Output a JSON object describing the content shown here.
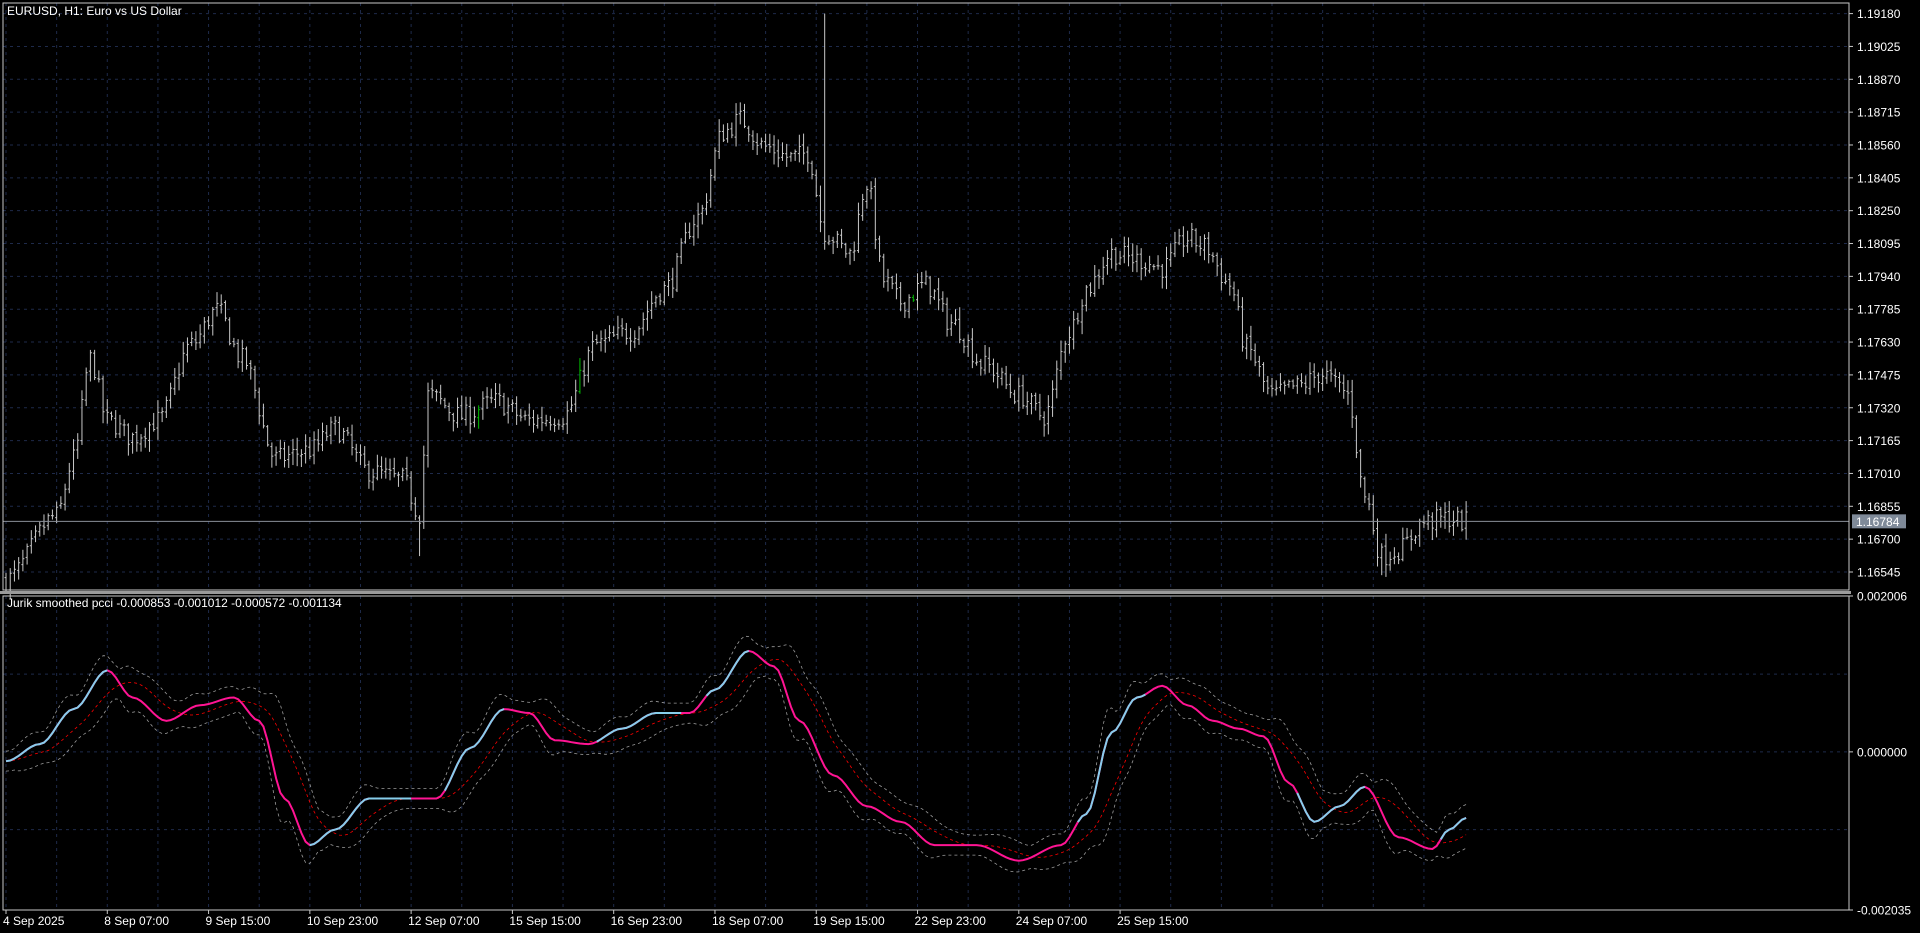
{
  "window": {
    "symbol_title": "EURUSD, H1:  Euro vs US Dollar",
    "indicator_title": "Jurik smoothed pcci -0.000853 -0.001012 -0.000572 -0.001134"
  },
  "colors": {
    "background": "#000000",
    "grid": "#1e2a4a",
    "frame": "#c8c8c8",
    "bar_normal": "#c8c8c8",
    "bar_green": "#00c000",
    "current_price_line": "#8a8f98",
    "current_price_box": "#7f8a99",
    "pcci_up": "#87ceeb",
    "pcci_down": "#ff1493",
    "signal": "#ff0000",
    "bands": "#9a9a9a"
  },
  "chart_data": [
    {
      "type": "candlestick-bars",
      "name": "EURUSD H1",
      "ylim": [
        1.1646,
        1.1923
      ],
      "y_ticks": [
        "1.19180",
        "1.19025",
        "1.18870",
        "1.18715",
        "1.18560",
        "1.18405",
        "1.18250",
        "1.18095",
        "1.17940",
        "1.17785",
        "1.17630",
        "1.17475",
        "1.17320",
        "1.17165",
        "1.17010",
        "1.16855",
        "1.16700",
        "1.16545"
      ],
      "current_price": 1.16784,
      "current_price_label": "1.16784",
      "keypoints": [
        {
          "i": 0,
          "y": 1.1651
        },
        {
          "i": 12,
          "y": 1.1681
        },
        {
          "i": 16,
          "y": 1.1708
        },
        {
          "i": 20,
          "y": 1.1755
        },
        {
          "i": 24,
          "y": 1.1726
        },
        {
          "i": 30,
          "y": 1.1718
        },
        {
          "i": 36,
          "y": 1.1726
        },
        {
          "i": 44,
          "y": 1.1762
        },
        {
          "i": 50,
          "y": 1.1778
        },
        {
          "i": 56,
          "y": 1.1755
        },
        {
          "i": 64,
          "y": 1.1708
        },
        {
          "i": 72,
          "y": 1.1712
        },
        {
          "i": 78,
          "y": 1.1722
        },
        {
          "i": 86,
          "y": 1.1702
        },
        {
          "i": 94,
          "y": 1.1698
        },
        {
          "i": 98,
          "y": 1.1682
        },
        {
          "i": 100,
          "y": 1.1738
        },
        {
          "i": 108,
          "y": 1.1728
        },
        {
          "i": 116,
          "y": 1.1735
        },
        {
          "i": 124,
          "y": 1.1726
        },
        {
          "i": 132,
          "y": 1.1728
        },
        {
          "i": 140,
          "y": 1.1762
        },
        {
          "i": 148,
          "y": 1.1768
        },
        {
          "i": 156,
          "y": 1.1788
        },
        {
          "i": 164,
          "y": 1.1822
        },
        {
          "i": 170,
          "y": 1.1862
        },
        {
          "i": 174,
          "y": 1.1868
        },
        {
          "i": 180,
          "y": 1.1855
        },
        {
          "i": 186,
          "y": 1.185
        },
        {
          "i": 190,
          "y": 1.1852
        },
        {
          "i": 194,
          "y": 1.1815
        },
        {
          "i": 200,
          "y": 1.1805
        },
        {
          "i": 204,
          "y": 1.1838
        },
        {
          "i": 208,
          "y": 1.1792
        },
        {
          "i": 212,
          "y": 1.1782
        },
        {
          "i": 218,
          "y": 1.179
        },
        {
          "i": 224,
          "y": 1.1772
        },
        {
          "i": 232,
          "y": 1.1752
        },
        {
          "i": 240,
          "y": 1.1738
        },
        {
          "i": 246,
          "y": 1.1728
        },
        {
          "i": 252,
          "y": 1.1768
        },
        {
          "i": 256,
          "y": 1.1788
        },
        {
          "i": 262,
          "y": 1.1805
        },
        {
          "i": 268,
          "y": 1.1802
        },
        {
          "i": 274,
          "y": 1.1798
        },
        {
          "i": 280,
          "y": 1.1812
        },
        {
          "i": 284,
          "y": 1.1808
        },
        {
          "i": 290,
          "y": 1.179
        },
        {
          "i": 294,
          "y": 1.176
        },
        {
          "i": 300,
          "y": 1.1738
        },
        {
          "i": 306,
          "y": 1.1742
        },
        {
          "i": 312,
          "y": 1.1748
        },
        {
          "i": 316,
          "y": 1.1742
        },
        {
          "i": 318,
          "y": 1.1738
        },
        {
          "i": 322,
          "y": 1.169
        },
        {
          "i": 326,
          "y": 1.1662
        },
        {
          "i": 330,
          "y": 1.1665
        },
        {
          "i": 336,
          "y": 1.1678
        },
        {
          "i": 342,
          "y": 1.168
        },
        {
          "i": 346,
          "y": 1.1678
        }
      ],
      "extremes": [
        {
          "i": 194,
          "high": 1.1918
        },
        {
          "i": 98,
          "low": 1.1662
        },
        {
          "i": 326,
          "low": 1.1653
        }
      ],
      "green_bars": [
        112,
        136,
        215
      ]
    },
    {
      "type": "line",
      "name": "Jurik smoothed pcci",
      "ylim": [
        -0.002035,
        0.002006
      ],
      "y_ticks": [
        "0.002006",
        "0.000000",
        "-0.002035"
      ],
      "values": [
        -0.000853,
        -0.001012,
        -0.000572,
        -0.001134
      ],
      "pcci_keypoints": [
        {
          "i": 0,
          "y": -0.00012
        },
        {
          "i": 8,
          "y": 0.0001
        },
        {
          "i": 16,
          "y": 0.00055
        },
        {
          "i": 24,
          "y": 0.00105
        },
        {
          "i": 30,
          "y": 0.0007
        },
        {
          "i": 38,
          "y": 0.0004
        },
        {
          "i": 46,
          "y": 0.0006
        },
        {
          "i": 54,
          "y": 0.0007
        },
        {
          "i": 60,
          "y": 0.0004
        },
        {
          "i": 66,
          "y": -0.0006
        },
        {
          "i": 72,
          "y": -0.0012
        },
        {
          "i": 78,
          "y": -0.001
        },
        {
          "i": 86,
          "y": -0.0006
        },
        {
          "i": 94,
          "y": -0.0006
        },
        {
          "i": 102,
          "y": -0.0006
        },
        {
          "i": 110,
          "y": 5e-05
        },
        {
          "i": 118,
          "y": 0.00055
        },
        {
          "i": 124,
          "y": 0.0005
        },
        {
          "i": 130,
          "y": 0.00015
        },
        {
          "i": 138,
          "y": 0.0001
        },
        {
          "i": 146,
          "y": 0.0003
        },
        {
          "i": 154,
          "y": 0.0005
        },
        {
          "i": 162,
          "y": 0.0005
        },
        {
          "i": 168,
          "y": 0.0008
        },
        {
          "i": 176,
          "y": 0.0013
        },
        {
          "i": 182,
          "y": 0.0011
        },
        {
          "i": 188,
          "y": 0.0004
        },
        {
          "i": 196,
          "y": -0.0003
        },
        {
          "i": 204,
          "y": -0.0007
        },
        {
          "i": 212,
          "y": -0.0009
        },
        {
          "i": 220,
          "y": -0.0012
        },
        {
          "i": 230,
          "y": -0.0012
        },
        {
          "i": 240,
          "y": -0.0014
        },
        {
          "i": 250,
          "y": -0.0012
        },
        {
          "i": 256,
          "y": -0.0008
        },
        {
          "i": 262,
          "y": 0.00025
        },
        {
          "i": 268,
          "y": 0.0007
        },
        {
          "i": 274,
          "y": 0.00085
        },
        {
          "i": 280,
          "y": 0.0006
        },
        {
          "i": 286,
          "y": 0.0004
        },
        {
          "i": 292,
          "y": 0.0003
        },
        {
          "i": 298,
          "y": 0.0002
        },
        {
          "i": 304,
          "y": -0.0004
        },
        {
          "i": 310,
          "y": -0.0009
        },
        {
          "i": 316,
          "y": -0.0007
        },
        {
          "i": 322,
          "y": -0.00045
        },
        {
          "i": 330,
          "y": -0.0011
        },
        {
          "i": 338,
          "y": -0.00125
        },
        {
          "i": 342,
          "y": -0.001
        },
        {
          "i": 346,
          "y": -0.00085
        }
      ],
      "band_spread": 0.00032,
      "band_extra_at_swings": 0.00025,
      "cyan_segments": [
        [
          0,
          24
        ],
        [
          72,
          96
        ],
        [
          104,
          118
        ],
        [
          140,
          160
        ],
        [
          166,
          176
        ],
        [
          254,
          270
        ],
        [
          306,
          322
        ],
        [
          340,
          346
        ]
      ]
    }
  ],
  "x_axis": {
    "labels": [
      {
        "i": 0,
        "text": "4 Sep 2025"
      },
      {
        "i": 24,
        "text": "8 Sep 07:00"
      },
      {
        "i": 48,
        "text": "9 Sep 15:00"
      },
      {
        "i": 72,
        "text": "10 Sep 23:00"
      },
      {
        "i": 96,
        "text": "12 Sep 07:00"
      },
      {
        "i": 120,
        "text": "15 Sep 15:00"
      },
      {
        "i": 144,
        "text": "16 Sep 23:00"
      },
      {
        "i": 168,
        "text": "18 Sep 07:00"
      },
      {
        "i": 192,
        "text": "19 Sep 15:00"
      },
      {
        "i": 216,
        "text": "22 Sep 23:00"
      },
      {
        "i": 240,
        "text": "24 Sep 07:00"
      },
      {
        "i": 264,
        "text": "25 Sep 15:00"
      }
    ]
  }
}
